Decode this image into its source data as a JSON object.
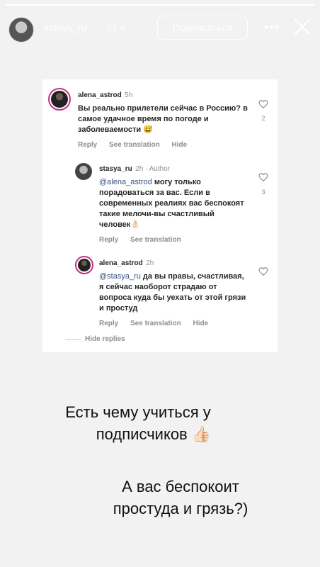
{
  "story": {
    "progress": 1.0,
    "username": "stasya_ru",
    "time": "21 ч.",
    "subscribe_label": "Подписаться"
  },
  "comments": [
    {
      "user": "alena_astrod",
      "meta": "5h",
      "text": "Вы реально прилетели сейчас в Россию? в самое удачное время по погоде и заболеваемости 😅",
      "actions": [
        "Reply",
        "See translation",
        "Hide"
      ],
      "likes": "2"
    },
    {
      "user": "stasya_ru",
      "meta": "2h · Author",
      "mention": "@alena_astrod",
      "text": "могу только порадоваться за вас. Если в современных реалиях вас беспокоят такие мелочи-вы счастливый человек👌🏻",
      "actions": [
        "Reply",
        "See translation"
      ],
      "likes": "3"
    },
    {
      "user": "alena_astrod",
      "meta": "2h",
      "mention": "@stasya_ru",
      "text": "да вы правы, счастливая, я сейчас наоборот страдаю от вопроса куда бы уехать от этой грязи и простуд",
      "actions": [
        "Reply",
        "See translation",
        "Hide"
      ]
    }
  ],
  "hide_replies_label": "Hide replies",
  "caption1": {
    "line1": "Есть чему учиться у",
    "line2": "подписчиков 👍🏻"
  },
  "caption2": {
    "line1": "А вас беспокоит",
    "line2": "простуда и грязь?)"
  },
  "colors": {
    "mention": "#385185",
    "avatar_ring": "#c13584",
    "background": "#f2f2f2"
  }
}
